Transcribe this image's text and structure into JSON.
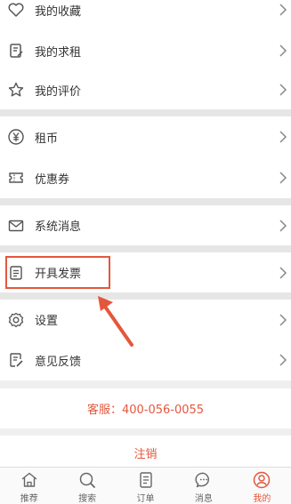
{
  "menu": {
    "favorites": "我的收藏",
    "my_rent_request": "我的求租",
    "my_reviews": "我的评价",
    "rent_coin": "租币",
    "coupons": "优惠券",
    "system_messages": "系统消息",
    "invoice": "开具发票",
    "settings": "设置",
    "feedback": "意见反馈"
  },
  "service": {
    "text": "客服：400-056-0055"
  },
  "logout": {
    "label": "注销"
  },
  "tabs": [
    {
      "label": "推荐",
      "icon": "home-icon"
    },
    {
      "label": "搜索",
      "icon": "search-icon"
    },
    {
      "label": "订单",
      "icon": "order-icon"
    },
    {
      "label": "消息",
      "icon": "message-icon"
    },
    {
      "label": "我的",
      "icon": "profile-icon"
    }
  ],
  "colors": {
    "accent": "#e4573d",
    "text": "#333333",
    "icon": "#555555",
    "background": "#efefef"
  }
}
